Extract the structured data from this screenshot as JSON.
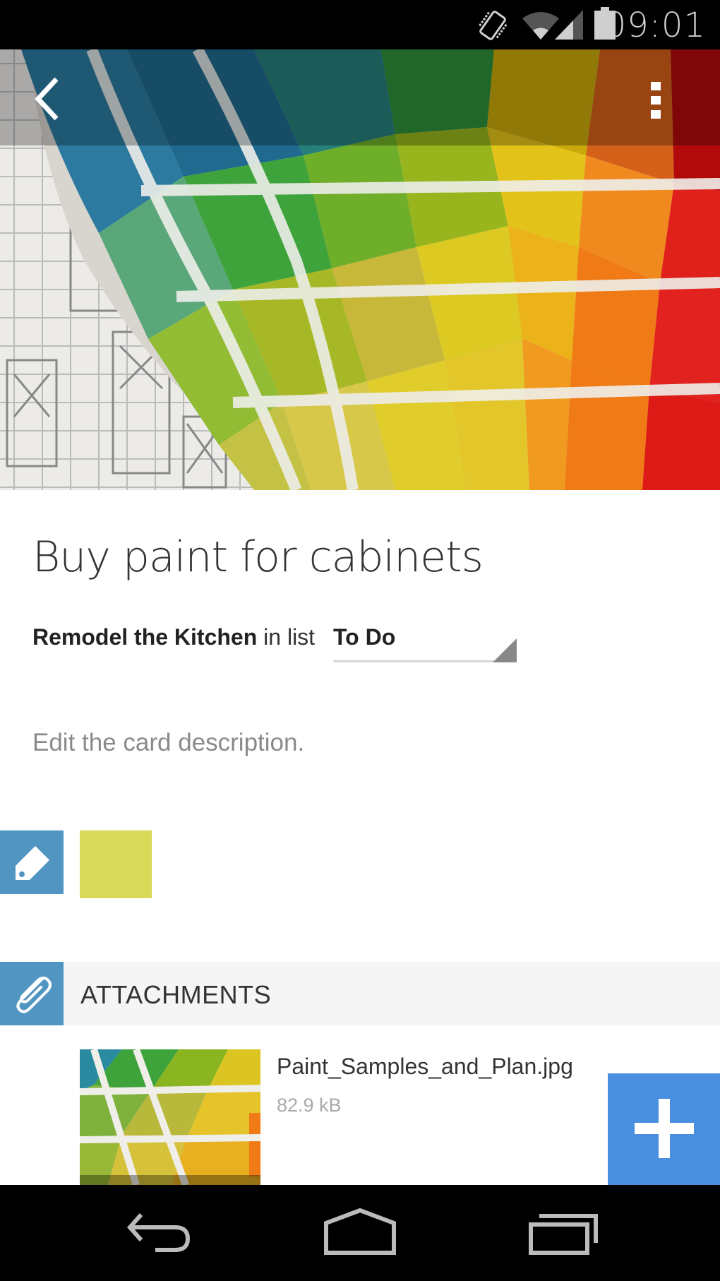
{
  "status_bar": {
    "time": "09:01",
    "icons": [
      "vibrate-icon",
      "wifi-icon",
      "signal-icon",
      "battery-icon"
    ]
  },
  "app_bar": {
    "back_icon": "chevron-left-icon",
    "overflow_icon": "more-vertical-icon"
  },
  "card": {
    "title": "Buy paint for cabinets",
    "board_name": "Remodel the Kitchen",
    "in_list_text": "in list",
    "list_selected": "To Do",
    "description_placeholder": "Edit the card description."
  },
  "labels": {
    "edit_icon": "tag-icon",
    "items": [
      {
        "color": "#d9d95a"
      }
    ]
  },
  "attachments": {
    "header": "ATTACHMENTS",
    "icon": "paperclip-icon",
    "items": [
      {
        "name": "Paint_Samples_and_Plan.jpg",
        "size": "82.9 kB"
      }
    ]
  },
  "fab": {
    "icon": "plus-icon",
    "color": "#4a8ee0"
  },
  "accent_color": "#5196c2",
  "nav_bar": {
    "items": [
      "back-icon",
      "home-icon",
      "recents-icon"
    ]
  }
}
